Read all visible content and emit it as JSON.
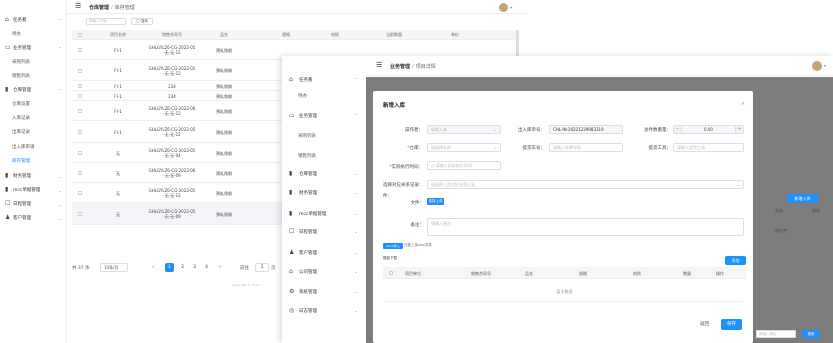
{
  "back": {
    "sidebar": [
      {
        "icon": "home-icon",
        "glyph": "⌂",
        "label": "任务看",
        "chev": "^",
        "sub": false
      },
      {
        "icon": "",
        "glyph": "",
        "label": "待办",
        "chev": "",
        "sub": true
      },
      {
        "icon": "doc-icon",
        "glyph": "▭",
        "label": "业务管理",
        "chev": "^",
        "sub": false
      },
      {
        "icon": "",
        "glyph": "",
        "label": "采购列表",
        "chev": "",
        "sub": true
      },
      {
        "icon": "",
        "glyph": "",
        "label": "销售列表",
        "chev": "",
        "sub": true
      },
      {
        "icon": "box-icon",
        "glyph": "▮",
        "label": "仓库管理",
        "chev": "^",
        "sub": false
      },
      {
        "icon": "",
        "glyph": "",
        "label": "仓库设置",
        "chev": "",
        "sub": true
      },
      {
        "icon": "",
        "glyph": "",
        "label": "入库记录",
        "chev": "",
        "sub": true
      },
      {
        "icon": "",
        "glyph": "",
        "label": "出库记录",
        "chev": "",
        "sub": true
      },
      {
        "icon": "",
        "glyph": "",
        "label": "出入库审请",
        "chev": "",
        "sub": true
      },
      {
        "icon": "",
        "glyph": "",
        "label": "库存管理",
        "chev": "",
        "sub": true,
        "active": true
      },
      {
        "icon": "asset-icon",
        "glyph": "▮",
        "label": "财务管理",
        "chev": "v",
        "sub": false
      },
      {
        "icon": "cart-icon",
        "glyph": "▮",
        "label": "mcc单据管理",
        "chev": "v",
        "sub": false
      },
      {
        "icon": "log-icon",
        "glyph": "☐",
        "label": "日程管理",
        "chev": "v",
        "sub": false
      },
      {
        "icon": "user-icon",
        "glyph": "♟",
        "label": "客户管理",
        "chev": "v",
        "sub": false
      }
    ],
    "crumb": {
      "c1": "仓库管理",
      "sep": "/",
      "c2": "库存管理"
    },
    "search": {
      "placeholder": "请输入产品",
      "button": "◯ 搜索"
    },
    "columns": [
      "项目名称",
      "销售合同号",
      "品名",
      "规格",
      "材质",
      "当前数量",
      "单价"
    ],
    "rows": [
      {
        "c": [
          "FI-1",
          "GHLGYLZ6-CG-2022-05\n-无-无-12",
          "预轧角钢",
          "",
          "",
          "",
          ""
        ]
      },
      {
        "c": [
          "FI-1",
          "GHLGYLZ6-CG-2022-05\n-无-无-12",
          "预轧角钢",
          "",
          "",
          "",
          ""
        ]
      },
      {
        "c": [
          "FI-1",
          "234",
          "预轧角钢",
          "",
          "",
          "",
          ""
        ]
      },
      {
        "c": [
          "FI-1",
          "234",
          "预轧角钢",
          "",
          "",
          "",
          ""
        ]
      },
      {
        "c": [
          "FI-1",
          "GHLGYLZ6-CG-2022-06\n-无-无-12",
          "预轧角钢",
          "",
          "",
          "",
          ""
        ]
      },
      {
        "c": [
          "FI-1",
          "GHLGYLZ6-CG-2022-05\n-无-无-12",
          "预轧角钢",
          "",
          "",
          "",
          ""
        ]
      },
      {
        "c": [
          "无",
          "GHLGYLZ6-CG-2022-05\n-无-无-04",
          "预轧角钢",
          "",
          "",
          "",
          ""
        ]
      },
      {
        "c": [
          "无",
          "GHLGYLZ6-CG-2022-06\n-无-无-09",
          "预轧角钢",
          "",
          "",
          "",
          ""
        ]
      },
      {
        "c": [
          "无",
          "GHLGYLZ6-CG-2022-05\n-无-无-12",
          "预轧角钢",
          "",
          "",
          "",
          ""
        ]
      },
      {
        "c": [
          "无",
          "GHLGYLZ6-CG-2022-05\n-无-无-09",
          "预轧角钢",
          "",
          "",
          "",
          ""
        ],
        "hl": true
      }
    ],
    "top_right_cells": [
      "预轧角钢",
      "",
      "0063",
      "",
      "",
      "2022-01-11"
    ],
    "pager": {
      "total": "共 37 条",
      "size": "10条/页",
      "prev": "<",
      "next": ">",
      "pages": [
        "1",
        "2",
        "3",
        "4"
      ],
      "current": "1",
      "goto": "前往",
      "page_val": "1",
      "page_word": "页"
    },
    "copyright": "Copyright © 2022 ..."
  },
  "mid": {
    "sidebar": [
      {
        "icon": "home-icon",
        "glyph": "⌂",
        "label": "任务看",
        "chev": "^",
        "sub": false
      },
      {
        "icon": "",
        "glyph": "",
        "label": "待办",
        "chev": "",
        "sub": true
      },
      {
        "icon": "doc-icon",
        "glyph": "▭",
        "label": "业务管理",
        "chev": "^",
        "sub": false
      },
      {
        "icon": "",
        "glyph": "",
        "label": "采购列表",
        "chev": "",
        "sub": true
      },
      {
        "icon": "",
        "glyph": "",
        "label": "销售列表",
        "chev": "",
        "sub": true
      },
      {
        "icon": "box-icon",
        "glyph": "▮",
        "label": "仓库管理",
        "chev": "v",
        "sub": false
      },
      {
        "icon": "asset-icon",
        "glyph": "▮",
        "label": "财务管理",
        "chev": "v",
        "sub": false
      },
      {
        "icon": "cart-icon",
        "glyph": "▮",
        "label": "mcc单据管理",
        "chev": "v",
        "sub": false
      },
      {
        "icon": "log-icon",
        "glyph": "☐",
        "label": "日程管理",
        "chev": "v",
        "sub": false
      },
      {
        "icon": "user-icon",
        "glyph": "♟",
        "label": "客户管理",
        "chev": "v",
        "sub": false
      },
      {
        "icon": "building-icon",
        "glyph": "⌂",
        "label": "公司管理",
        "chev": "v",
        "sub": false
      },
      {
        "icon": "gear-icon",
        "glyph": "⚙",
        "label": "系统管理",
        "chev": "v",
        "sub": false
      },
      {
        "icon": "log-icon",
        "glyph": "◎",
        "label": "日志管理",
        "chev": "v",
        "sub": false
      }
    ],
    "crumb": {
      "c1": "业务管理",
      "sep": "/",
      "c2": "项目详情"
    },
    "right": {
      "add_btn": "新增入库",
      "t1": "状态",
      "t2": "操作",
      "t3": "进行中",
      "input_ph": "请输入单位",
      "search": "搜索"
    }
  },
  "modal": {
    "title": "新增入库",
    "close": "×",
    "fields": {
      "operator_label": "操作者：",
      "operator_ph": "请输入者",
      "in_no_label": "出入库单号：",
      "in_no_val": "CHL-IN-20221229083319",
      "qty_label": "总件数重量：",
      "qty_val": "0.00",
      "qty_minus": "−",
      "qty_plus": "+",
      "warehouse_label": "仓库：",
      "warehouse_ph": "请选择仓库",
      "car_label": "提货车号：",
      "car_ph": "请输入车牌号码",
      "tool_label": "提货工具：",
      "tool_ph": "请输入提货工具",
      "time_label": "实际执行时间：",
      "time_ph": "请输入实际执行时间",
      "relation_label": "选择对应关系记录：",
      "relation_ph": "请选择入库对应关系记录",
      "attach_label": "件：",
      "file_label": "文件：",
      "upload_btn": "选择上传",
      "remark_label": "备注：",
      "remark_ph": "请输入备注"
    },
    "excel_btn": "excel导入",
    "excel_hint": "只能上传xlsx文件",
    "template_link": "模板下载",
    "add_btn": "添加",
    "table_cols": [
      "项目单位",
      "销售合同号",
      "品名",
      "规格",
      "材质",
      "数量",
      "操作"
    ],
    "empty": "暂无数据",
    "cancel": "返回",
    "save": "保存"
  }
}
